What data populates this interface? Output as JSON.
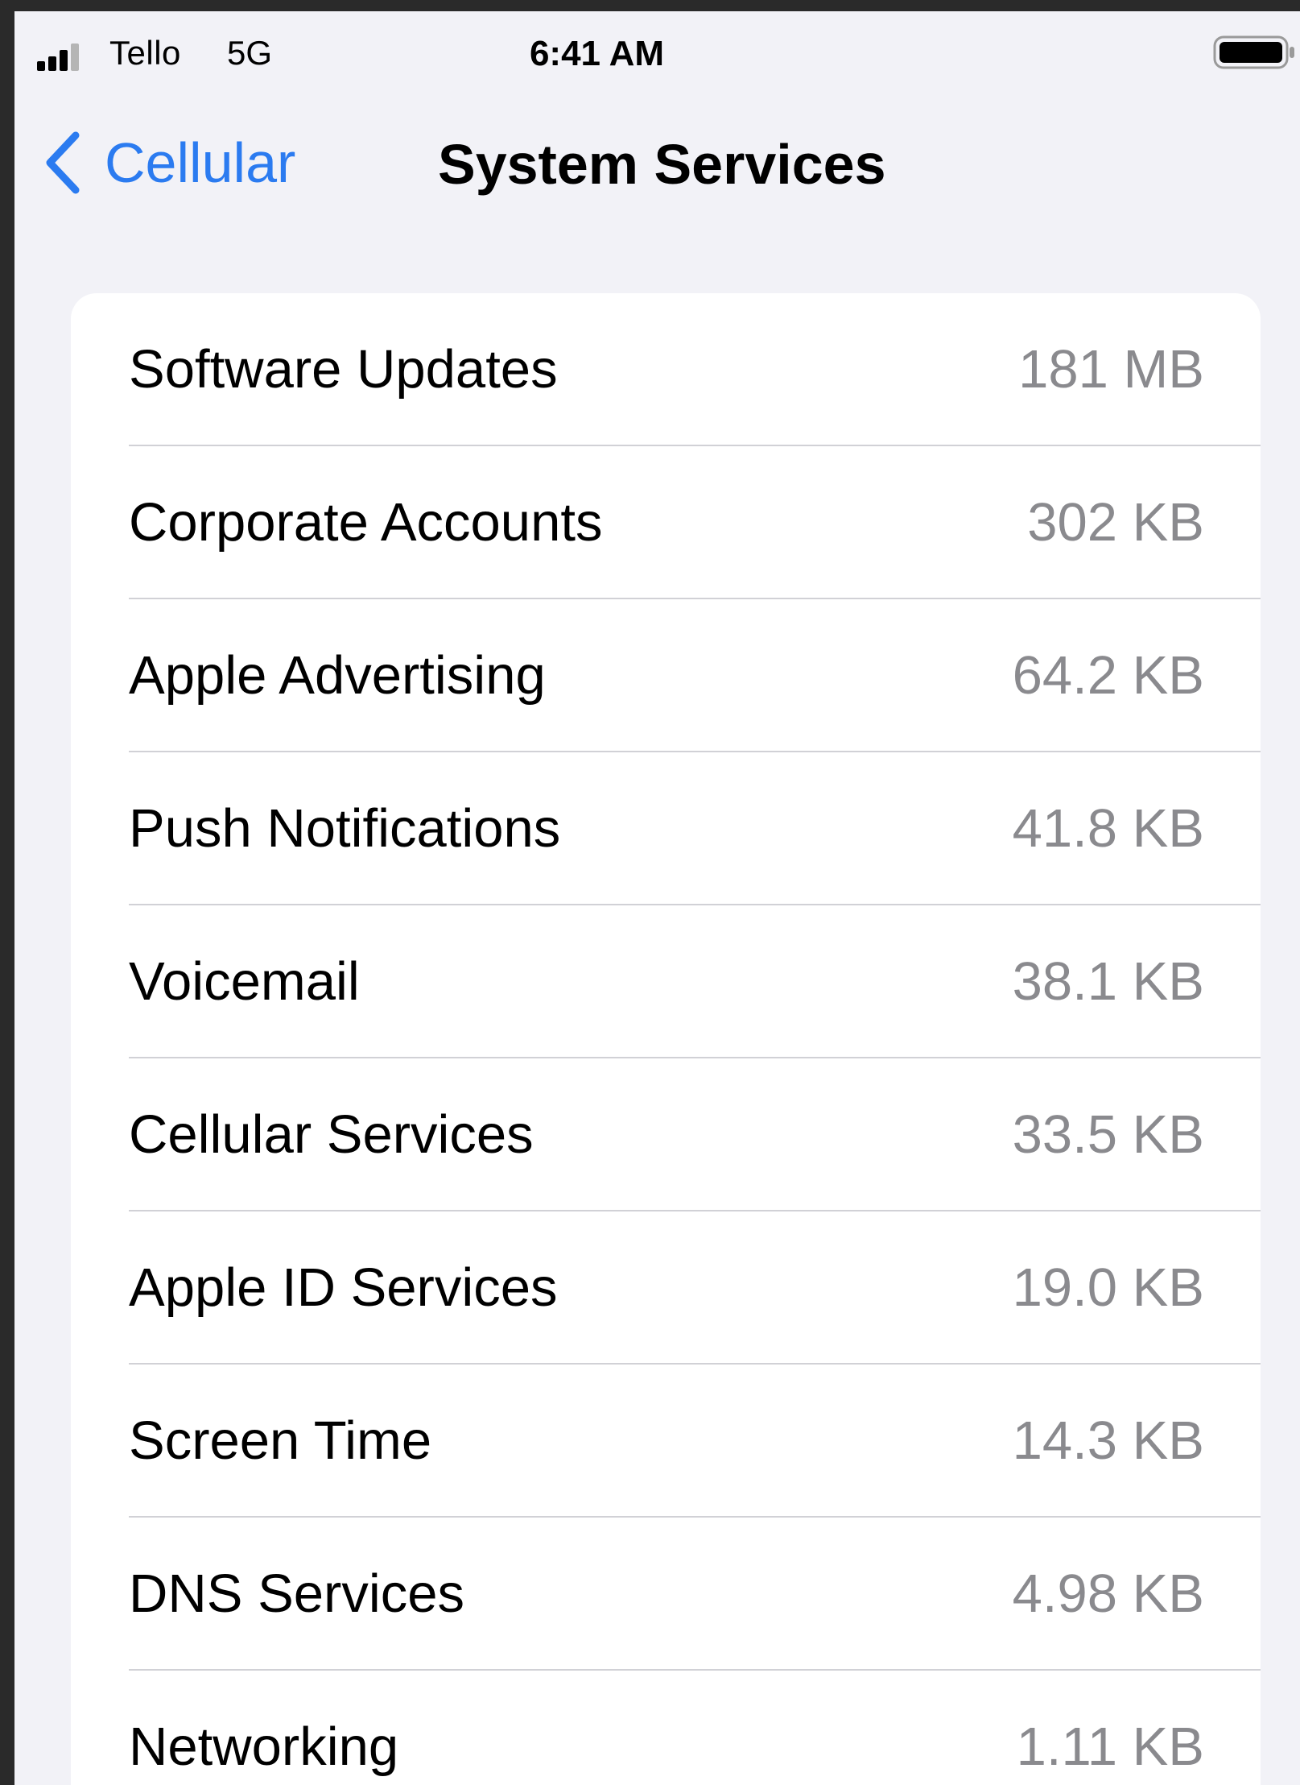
{
  "status_bar": {
    "carrier": "Tello",
    "network": "5G",
    "time": "6:41 AM",
    "signal_bars_filled": 3,
    "signal_bars_total": 4,
    "battery_level": 0.95
  },
  "nav": {
    "back_label": "Cellular",
    "title": "System Services",
    "accent_color": "#2b7bf0"
  },
  "services": [
    {
      "label": "Software Updates",
      "value": "181 MB"
    },
    {
      "label": "Corporate Accounts",
      "value": "302 KB"
    },
    {
      "label": "Apple Advertising",
      "value": "64.2 KB"
    },
    {
      "label": "Push Notifications",
      "value": "41.8 KB"
    },
    {
      "label": "Voicemail",
      "value": "38.1 KB"
    },
    {
      "label": "Cellular Services",
      "value": "33.5 KB"
    },
    {
      "label": "Apple ID Services",
      "value": "19.0 KB"
    },
    {
      "label": "Screen Time",
      "value": "14.3 KB"
    },
    {
      "label": "DNS Services",
      "value": "4.98 KB"
    },
    {
      "label": "Networking",
      "value": "1.11 KB"
    }
  ]
}
